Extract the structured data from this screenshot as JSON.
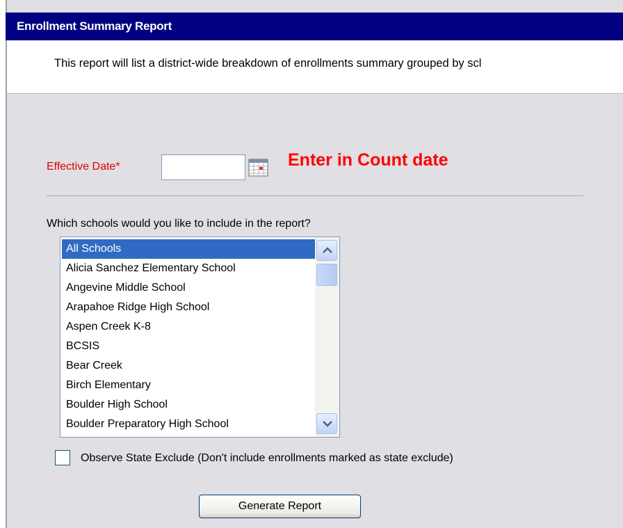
{
  "header": {
    "title": "Enrollment Summary Report",
    "description": "This report will list a district-wide breakdown of enrollments summary grouped by scl"
  },
  "form": {
    "effective_date_label": "Effective Date*",
    "effective_date_value": "",
    "calendar_icon": "calendar-icon",
    "annotation": "Enter in Count date",
    "annotation_color": "#ff0000",
    "question": "Which schools would you like to include in the report?",
    "schools": [
      "All Schools",
      "Alicia Sanchez Elementary School",
      "Angevine Middle School",
      "Arapahoe Ridge High School",
      "Aspen Creek K-8",
      "BCSIS",
      "Bear Creek",
      "Birch Elementary",
      "Boulder High School",
      "Boulder Preparatory High School"
    ],
    "selected_school": "All Schools",
    "selection_color": "#316ac5",
    "state_exclude_label": "Observe State Exclude (Don't include enrollments marked as state exclude)",
    "state_exclude_checked": false,
    "generate_button_label": "Generate Report"
  },
  "colors": {
    "title_bar": "#000080",
    "label_required": "#e00000",
    "background": "#e0dfe3"
  }
}
